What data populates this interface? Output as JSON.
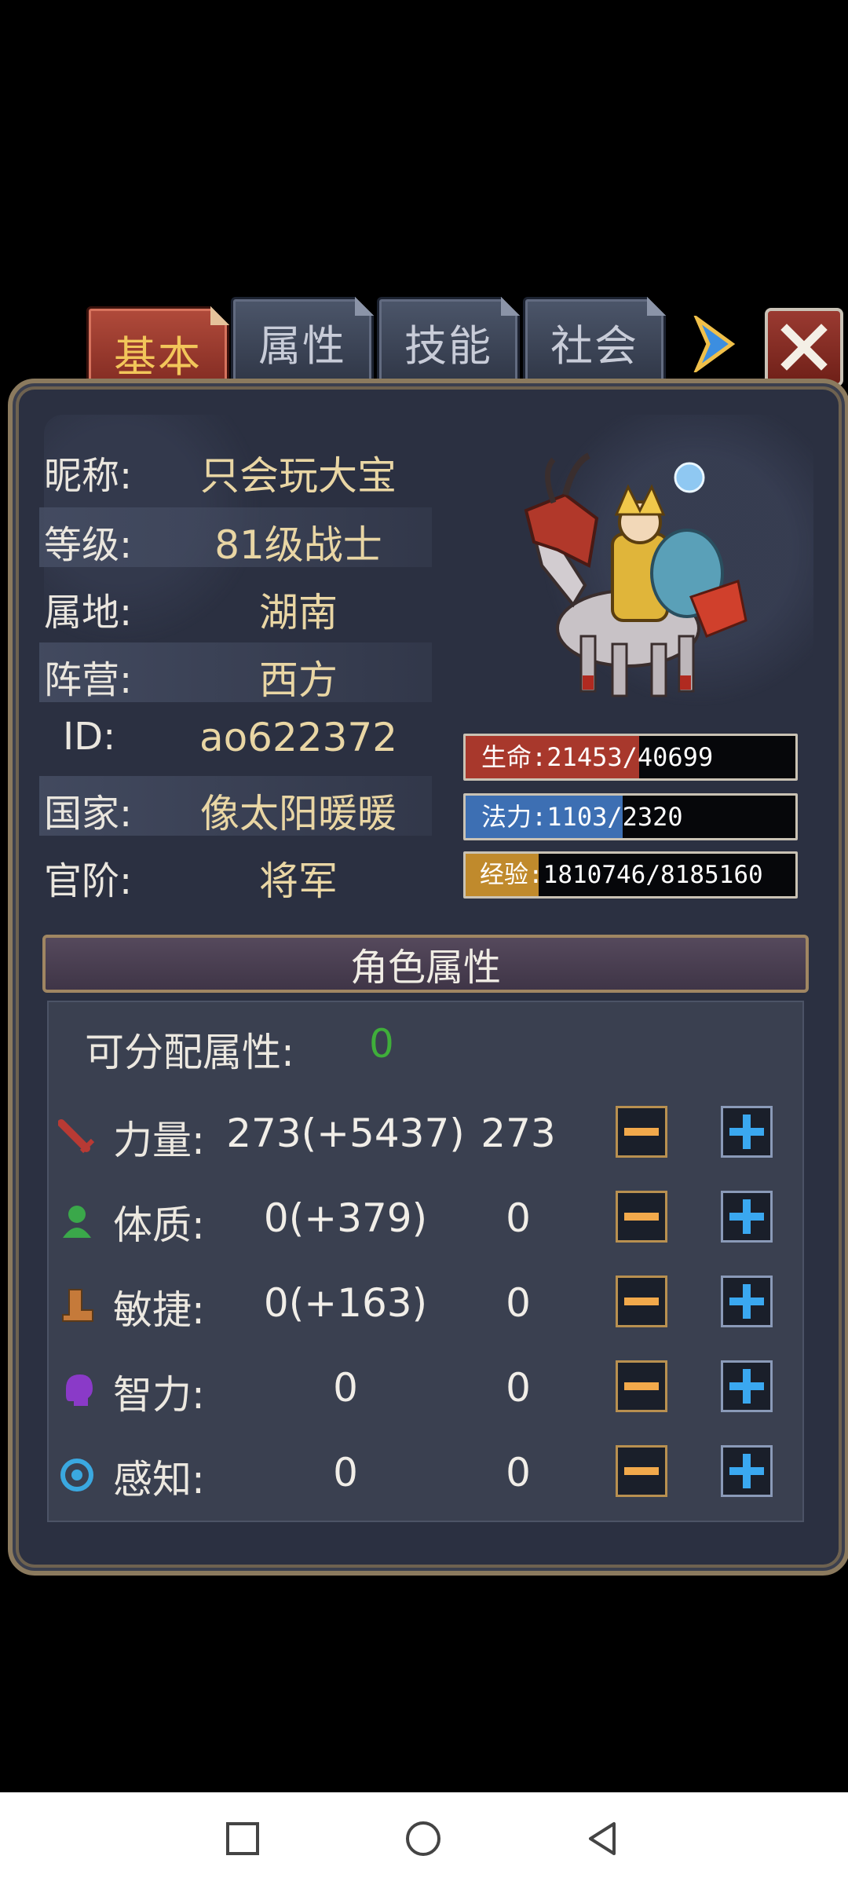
{
  "tabs": [
    {
      "label": "基本",
      "active": true
    },
    {
      "label": "属性",
      "active": false
    },
    {
      "label": "技能",
      "active": false
    },
    {
      "label": "社会",
      "active": false
    }
  ],
  "info": {
    "nickname_label": "昵称:",
    "nickname": "只会玩大宝",
    "level_label": "等级:",
    "level": "81级战士",
    "territory_label": "属地:",
    "territory": "湖南",
    "camp_label": "阵营:",
    "camp": "西方",
    "id_label": "ID:",
    "id": "ao622372",
    "country_label": "国家:",
    "country": "像太阳暖暖",
    "rank_label": "官阶:",
    "rank": "将军"
  },
  "bars": {
    "hp": {
      "label": "生命",
      "current": "21453",
      "max": "40699",
      "fraction": 0.527,
      "color": "#a8382c"
    },
    "mp": {
      "label": "法力",
      "current": "1103",
      "max": "2320",
      "fraction": 0.475,
      "color": "#3d6fb3"
    },
    "exp": {
      "label": "经验",
      "current": "1810746",
      "max": "8185160",
      "fraction": 0.221,
      "color": "#c08a2c"
    }
  },
  "attributes": {
    "section_title": "角色属性",
    "free_points_label": "可分配属性:",
    "free_points": "0",
    "rows": [
      {
        "name": "力量:",
        "total": "273(+5437)",
        "base": "273",
        "icon": "sword-icon"
      },
      {
        "name": "体质:",
        "total": "0(+379)",
        "base": "0",
        "icon": "person-icon"
      },
      {
        "name": "敏捷:",
        "total": "0(+163)",
        "base": "0",
        "icon": "boot-icon"
      },
      {
        "name": "智力:",
        "total": "0",
        "base": "0",
        "icon": "head-icon"
      },
      {
        "name": "感知:",
        "total": "0",
        "base": "0",
        "icon": "eye-icon"
      }
    ]
  }
}
